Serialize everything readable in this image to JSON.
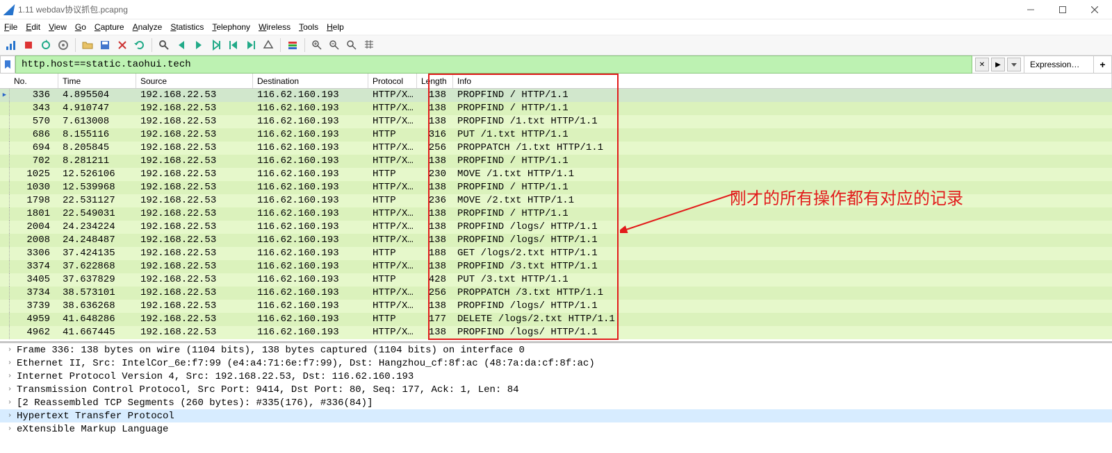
{
  "window": {
    "title": "1.11 webdav协议抓包.pcapng"
  },
  "menu": {
    "items": [
      {
        "key": "file",
        "label": "File",
        "accel": "F"
      },
      {
        "key": "edit",
        "label": "Edit",
        "accel": "E"
      },
      {
        "key": "view",
        "label": "View",
        "accel": "V"
      },
      {
        "key": "go",
        "label": "Go",
        "accel": "G"
      },
      {
        "key": "capture",
        "label": "Capture",
        "accel": "C"
      },
      {
        "key": "analyze",
        "label": "Analyze",
        "accel": "A"
      },
      {
        "key": "statistics",
        "label": "Statistics",
        "accel": "S"
      },
      {
        "key": "telephony",
        "label": "Telephony",
        "accel": "T"
      },
      {
        "key": "wireless",
        "label": "Wireless",
        "accel": "W"
      },
      {
        "key": "tools",
        "label": "Tools",
        "accel": "T"
      },
      {
        "key": "help",
        "label": "Help",
        "accel": "H"
      }
    ]
  },
  "filter": {
    "expression": "http.host==static.taohui.tech",
    "clear_label": "✕",
    "apply_label": "▶",
    "expression_button": "Expression…",
    "plus_label": "+"
  },
  "packet_list": {
    "columns": [
      "No.",
      "Time",
      "Source",
      "Destination",
      "Protocol",
      "Length",
      "Info"
    ],
    "selected_index": 0,
    "rows": [
      {
        "no": 336,
        "time": "4.895504",
        "src": "192.168.22.53",
        "dst": "116.62.160.193",
        "proto": "HTTP/X…",
        "len": 138,
        "info": "PROPFIND / HTTP/1.1"
      },
      {
        "no": 343,
        "time": "4.910747",
        "src": "192.168.22.53",
        "dst": "116.62.160.193",
        "proto": "HTTP/X…",
        "len": 138,
        "info": "PROPFIND / HTTP/1.1"
      },
      {
        "no": 570,
        "time": "7.613008",
        "src": "192.168.22.53",
        "dst": "116.62.160.193",
        "proto": "HTTP/X…",
        "len": 138,
        "info": "PROPFIND /1.txt HTTP/1.1"
      },
      {
        "no": 686,
        "time": "8.155116",
        "src": "192.168.22.53",
        "dst": "116.62.160.193",
        "proto": "HTTP",
        "len": 316,
        "info": "PUT /1.txt HTTP/1.1"
      },
      {
        "no": 694,
        "time": "8.205845",
        "src": "192.168.22.53",
        "dst": "116.62.160.193",
        "proto": "HTTP/X…",
        "len": 256,
        "info": "PROPPATCH /1.txt HTTP/1.1"
      },
      {
        "no": 702,
        "time": "8.281211",
        "src": "192.168.22.53",
        "dst": "116.62.160.193",
        "proto": "HTTP/X…",
        "len": 138,
        "info": "PROPFIND / HTTP/1.1"
      },
      {
        "no": 1025,
        "time": "12.526106",
        "src": "192.168.22.53",
        "dst": "116.62.160.193",
        "proto": "HTTP",
        "len": 230,
        "info": "MOVE /1.txt HTTP/1.1"
      },
      {
        "no": 1030,
        "time": "12.539968",
        "src": "192.168.22.53",
        "dst": "116.62.160.193",
        "proto": "HTTP/X…",
        "len": 138,
        "info": "PROPFIND / HTTP/1.1"
      },
      {
        "no": 1798,
        "time": "22.531127",
        "src": "192.168.22.53",
        "dst": "116.62.160.193",
        "proto": "HTTP",
        "len": 236,
        "info": "MOVE /2.txt HTTP/1.1"
      },
      {
        "no": 1801,
        "time": "22.549031",
        "src": "192.168.22.53",
        "dst": "116.62.160.193",
        "proto": "HTTP/X…",
        "len": 138,
        "info": "PROPFIND / HTTP/1.1"
      },
      {
        "no": 2004,
        "time": "24.234224",
        "src": "192.168.22.53",
        "dst": "116.62.160.193",
        "proto": "HTTP/X…",
        "len": 138,
        "info": "PROPFIND /logs/ HTTP/1.1"
      },
      {
        "no": 2008,
        "time": "24.248487",
        "src": "192.168.22.53",
        "dst": "116.62.160.193",
        "proto": "HTTP/X…",
        "len": 138,
        "info": "PROPFIND /logs/ HTTP/1.1"
      },
      {
        "no": 3306,
        "time": "37.424135",
        "src": "192.168.22.53",
        "dst": "116.62.160.193",
        "proto": "HTTP",
        "len": 188,
        "info": "GET /logs/2.txt HTTP/1.1"
      },
      {
        "no": 3374,
        "time": "37.622868",
        "src": "192.168.22.53",
        "dst": "116.62.160.193",
        "proto": "HTTP/X…",
        "len": 138,
        "info": "PROPFIND /3.txt HTTP/1.1"
      },
      {
        "no": 3405,
        "time": "37.637829",
        "src": "192.168.22.53",
        "dst": "116.62.160.193",
        "proto": "HTTP",
        "len": 428,
        "info": "PUT /3.txt HTTP/1.1"
      },
      {
        "no": 3734,
        "time": "38.573101",
        "src": "192.168.22.53",
        "dst": "116.62.160.193",
        "proto": "HTTP/X…",
        "len": 256,
        "info": "PROPPATCH /3.txt HTTP/1.1"
      },
      {
        "no": 3739,
        "time": "38.636268",
        "src": "192.168.22.53",
        "dst": "116.62.160.193",
        "proto": "HTTP/X…",
        "len": 138,
        "info": "PROPFIND /logs/ HTTP/1.1"
      },
      {
        "no": 4959,
        "time": "41.648286",
        "src": "192.168.22.53",
        "dst": "116.62.160.193",
        "proto": "HTTP",
        "len": 177,
        "info": "DELETE /logs/2.txt HTTP/1.1"
      },
      {
        "no": 4962,
        "time": "41.667445",
        "src": "192.168.22.53",
        "dst": "116.62.160.193",
        "proto": "HTTP/X…",
        "len": 138,
        "info": "PROPFIND /logs/ HTTP/1.1"
      }
    ]
  },
  "details": {
    "selected_index": 5,
    "lines": [
      "Frame 336: 138 bytes on wire (1104 bits), 138 bytes captured (1104 bits) on interface 0",
      "Ethernet II, Src: IntelCor_6e:f7:99 (e4:a4:71:6e:f7:99), Dst: Hangzhou_cf:8f:ac (48:7a:da:cf:8f:ac)",
      "Internet Protocol Version 4, Src: 192.168.22.53, Dst: 116.62.160.193",
      "Transmission Control Protocol, Src Port: 9414, Dst Port: 80, Seq: 177, Ack: 1, Len: 84",
      "[2 Reassembled TCP Segments (260 bytes): #335(176), #336(84)]",
      "Hypertext Transfer Protocol",
      "eXtensible Markup Language"
    ]
  },
  "annotation": {
    "text": "刚才的所有操作都有对应的记录"
  }
}
